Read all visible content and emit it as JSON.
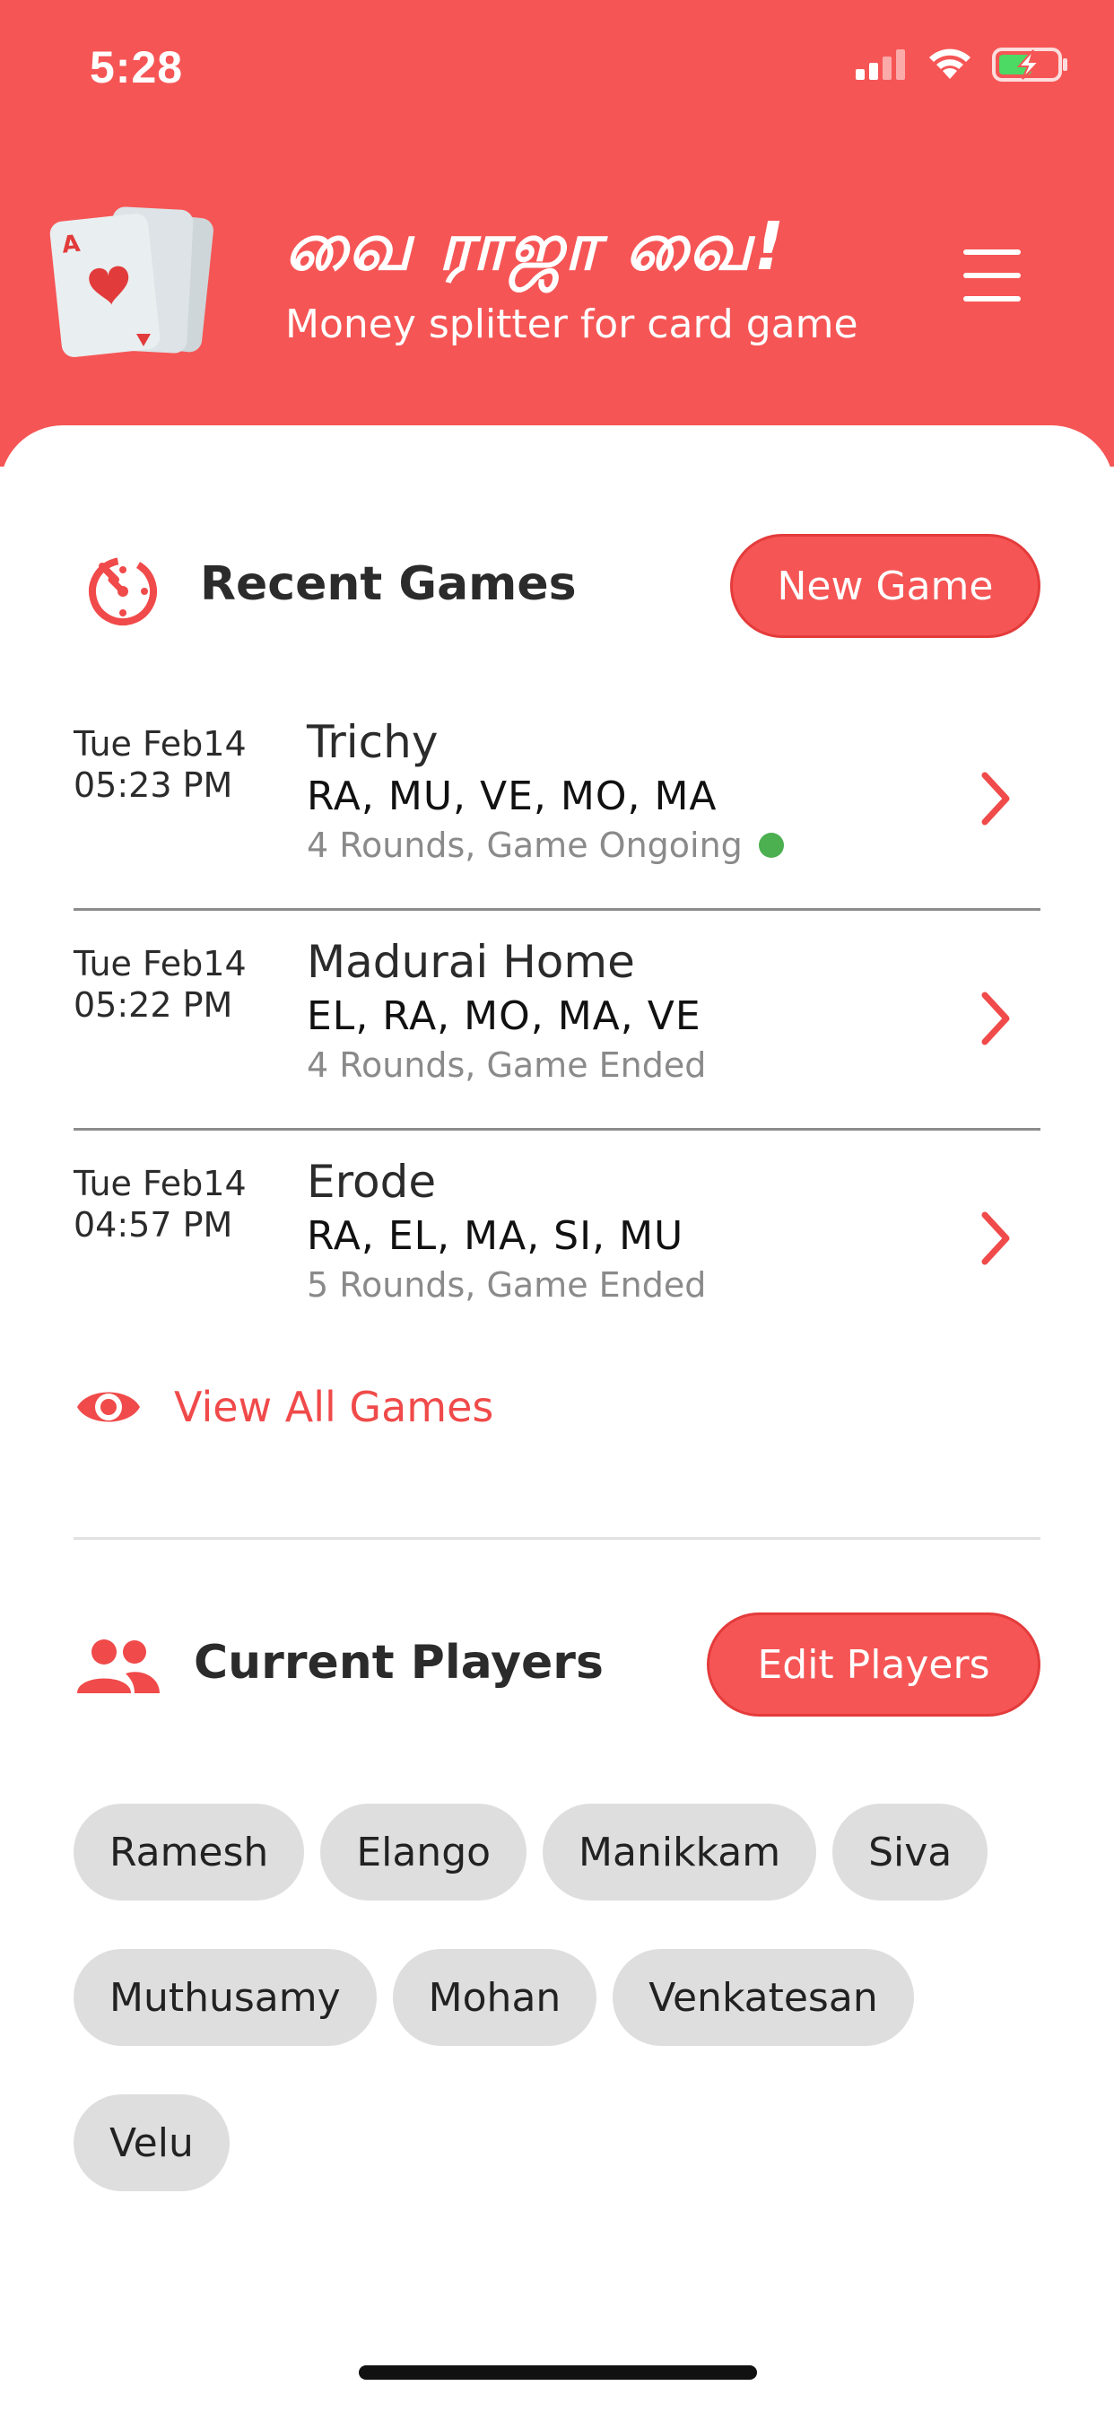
{
  "status_bar": {
    "time": "5:28"
  },
  "header": {
    "title": "வை ராஜா வை!",
    "subtitle": "Money splitter for card game",
    "logo_icon": "playing-cards-heart-icon",
    "menu_icon": "hamburger-menu-icon"
  },
  "recent_games": {
    "title": "Recent Games",
    "icon": "timer-icon",
    "new_game_label": "New Game",
    "games": [
      {
        "day": "Tue Feb14",
        "time": "05:23 PM",
        "name": "Trichy",
        "players": "RA, MU, VE, MO, MA",
        "status": "4 Rounds, Game Ongoing",
        "ongoing": true
      },
      {
        "day": "Tue Feb14",
        "time": "05:22 PM",
        "name": "Madurai Home",
        "players": "EL, RA, MO, MA, VE",
        "status": "4 Rounds, Game Ended",
        "ongoing": false
      },
      {
        "day": "Tue Feb14",
        "time": "04:57 PM",
        "name": "Erode",
        "players": "RA, EL, MA, SI, MU",
        "status": "5 Rounds, Game Ended",
        "ongoing": false
      }
    ],
    "view_all_label": "View All Games",
    "view_all_icon": "eye-icon"
  },
  "current_players": {
    "title": "Current Players",
    "icon": "people-icon",
    "edit_label": "Edit Players",
    "players": [
      "Ramesh",
      "Elango",
      "Manikkam",
      "Siva",
      "Muthusamy",
      "Mohan",
      "Venkatesan",
      "Velu"
    ]
  },
  "colors": {
    "accent": "#f65555",
    "ongoing": "#4caf50"
  }
}
